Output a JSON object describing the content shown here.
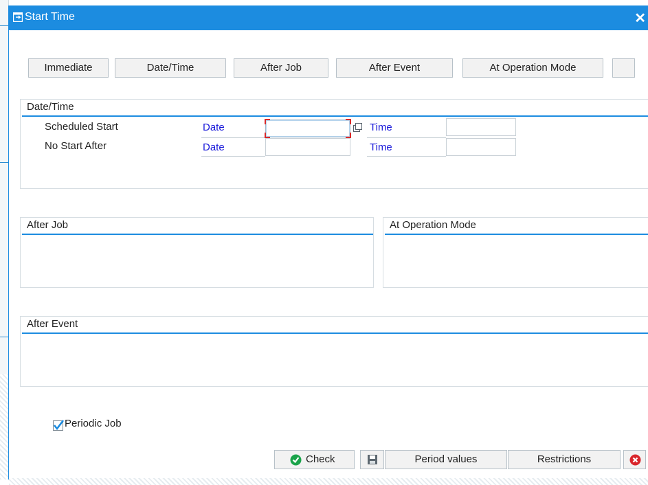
{
  "dialog": {
    "title": "Start Time",
    "close_glyph": "✕"
  },
  "start_buttons": [
    "Immediate",
    "Date/Time",
    "After Job",
    "After Event",
    "At Operation Mode",
    ""
  ],
  "datetime_group": {
    "title": "Date/Time",
    "rows": [
      {
        "label": "Scheduled Start",
        "date_label": "Date",
        "date_value": "",
        "time_label": "Time",
        "time_value": ""
      },
      {
        "label": "No Start After",
        "date_label": "Date",
        "date_value": "",
        "time_label": "Time",
        "time_value": ""
      }
    ]
  },
  "after_job_group": {
    "title": "After Job"
  },
  "op_mode_group": {
    "title": "At Operation Mode"
  },
  "after_event_group": {
    "title": "After Event"
  },
  "periodic": {
    "label": "Periodic Job",
    "checked": true
  },
  "footer": {
    "check_label": "Check",
    "period_values_label": "Period values",
    "restrictions_label": "Restrictions"
  },
  "colors": {
    "accent": "#1c8ce0",
    "field_label": "#1717d9",
    "check_green": "#1aa34a",
    "cancel_red": "#d9262c"
  },
  "icons": [
    "dialog-icon",
    "close-icon",
    "value-help-icon",
    "check-icon",
    "save-icon",
    "cancel-icon"
  ]
}
